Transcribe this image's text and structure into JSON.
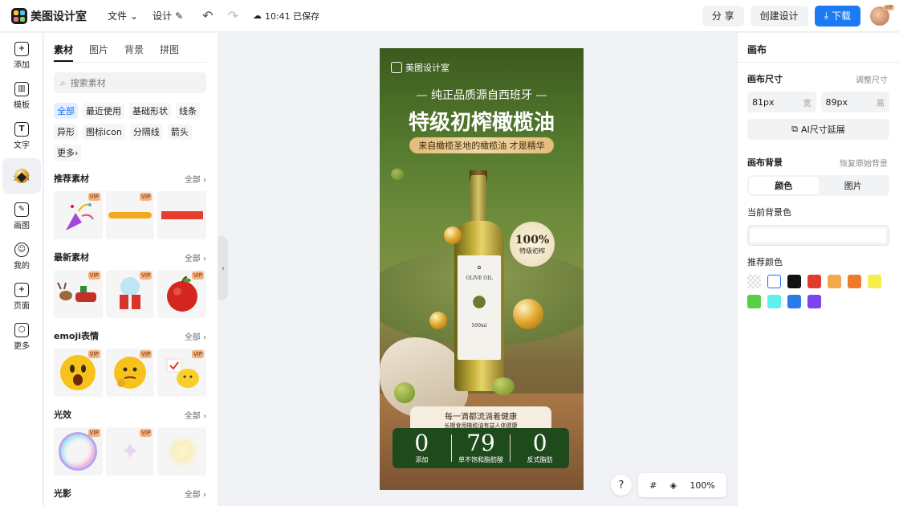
{
  "topbar": {
    "app_name": "美图设计室",
    "menu_file": "文件",
    "menu_design": "设计",
    "saved_status": "10:41 已保存",
    "share_label": "分 享",
    "create_label": "创建设计",
    "download_label": "下载",
    "avatar_vip": "VIP"
  },
  "rail": {
    "items": [
      {
        "label": "添加",
        "icon": "plus-icon"
      },
      {
        "label": "模板",
        "icon": "template-icon"
      },
      {
        "label": "文字",
        "icon": "text-icon"
      },
      {
        "label": "元素",
        "icon": "shapes-icon"
      },
      {
        "label": "画图",
        "icon": "pen-icon"
      },
      {
        "label": "我的",
        "icon": "user-icon"
      },
      {
        "label": "页面",
        "icon": "page-icon"
      },
      {
        "label": "更多",
        "icon": "cube-icon"
      }
    ]
  },
  "panel": {
    "tabs": [
      "素材",
      "图片",
      "背景",
      "拼图"
    ],
    "search_placeholder": "搜索素材",
    "chips": [
      "全部",
      "最近使用",
      "基础形状",
      "线条",
      "异形",
      "图标icon",
      "分隔线",
      "箭头",
      "更多"
    ],
    "all_label": "全部",
    "vip": "VIP",
    "sections": {
      "recommended": "推荐素材",
      "latest": "最新素材",
      "emoji": "emoji表情",
      "light": "光效",
      "shadow": "光影"
    }
  },
  "poster": {
    "brand": "美图设计室",
    "subtitle": "— 纯正品质源自西班牙 —",
    "title": "特级初榨橄榄油",
    "tagline": "来自橄榄圣地的橄榄油 才是精华",
    "badge_value": "100%",
    "badge_text": "特级初榨",
    "bottle_text": "OLIVE OIL",
    "bottle_volume": "500ml",
    "note_line1": "每一滴都流淌着健康",
    "note_line2": "长期食用橄榄油有益人体健康",
    "stats": [
      {
        "value": "0",
        "caption": "添加"
      },
      {
        "value": "79",
        "caption": "单不饱和脂肪酸"
      },
      {
        "value": "0",
        "caption": "反式脂肪"
      }
    ]
  },
  "controls": {
    "help": "?",
    "zoom": "100%"
  },
  "right_panel": {
    "title": "画布",
    "size_label": "画布尺寸",
    "adjust_label": "调整尺寸",
    "width_value": "81px",
    "width_unit": "宽",
    "height_value": "89px",
    "height_unit": "高",
    "ai_button": "AI尺寸延展",
    "bg_label": "画布背景",
    "restore_label": "恢复原始背景",
    "seg_color": "颜色",
    "seg_image": "图片",
    "current_bg_label": "当前背景色",
    "recommended_label": "推荐颜色",
    "swatches": [
      "transparent",
      "#ffffff",
      "#111111",
      "#e23b2e",
      "#f3a94a",
      "#ee7a2c",
      "#f6ef4a",
      "#58cf45",
      "#5ef0ee",
      "#2a7be8",
      "#7b44ee"
    ]
  }
}
